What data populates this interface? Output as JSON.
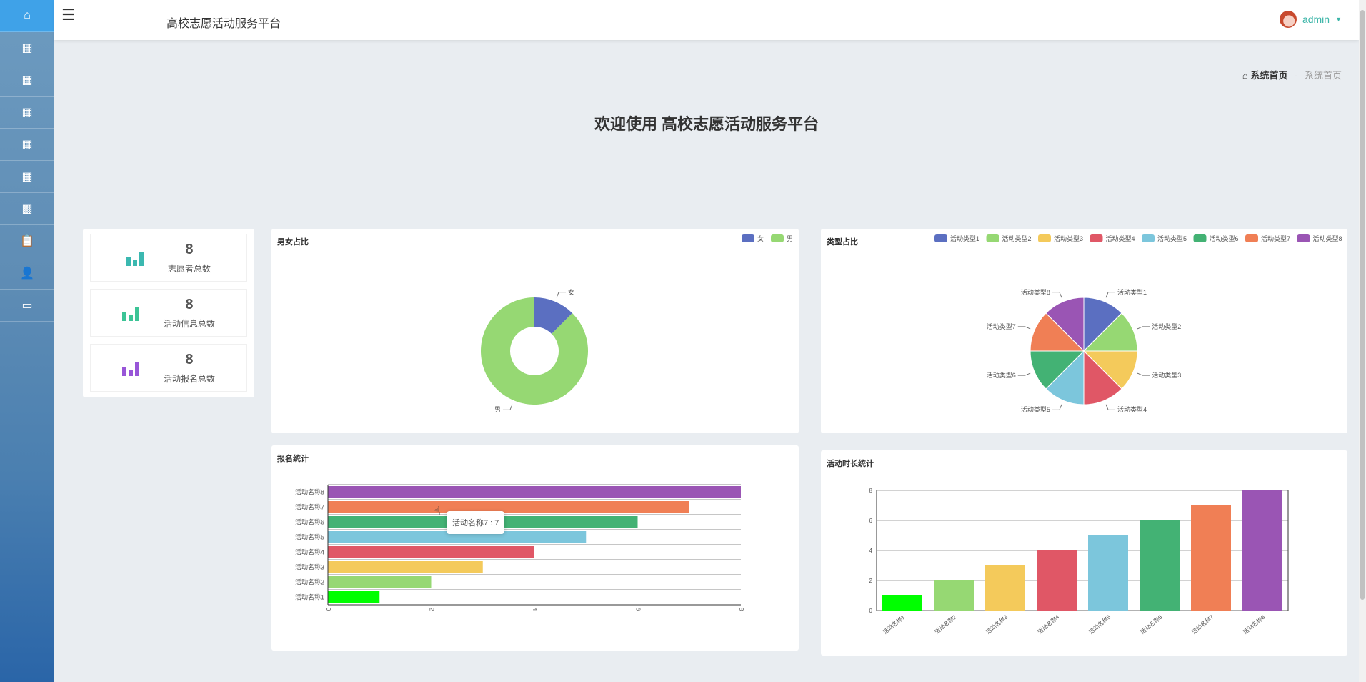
{
  "header": {
    "app_title": "高校志愿活动服务平台",
    "user": "admin"
  },
  "sidebar": {
    "items": [
      {
        "icon": "home-icon"
      },
      {
        "icon": "grid-icon"
      },
      {
        "icon": "grid-icon"
      },
      {
        "icon": "grid-icon"
      },
      {
        "icon": "grid-icon"
      },
      {
        "icon": "grid-icon"
      },
      {
        "icon": "apps-icon"
      },
      {
        "icon": "clipboard-icon"
      },
      {
        "icon": "user-icon"
      },
      {
        "icon": "card-icon"
      }
    ]
  },
  "breadcrumb": {
    "home": "系统首页",
    "sep": "-",
    "current": "系统首页"
  },
  "welcome": "欢迎使用 高校志愿活动服务平台",
  "stats": [
    {
      "value": "8",
      "label": "志愿者总数",
      "color": "#3bb8b0"
    },
    {
      "value": "8",
      "label": "活动信息总数",
      "color": "#3cc496"
    },
    {
      "value": "8",
      "label": "活动报名总数",
      "color": "#9856d8"
    }
  ],
  "colors": [
    "#5b6fc1",
    "#96d873",
    "#f4ca5b",
    "#e05766",
    "#7cc6dc",
    "#43b274",
    "#f07f55",
    "#9a55b4"
  ],
  "chart_data": [
    {
      "type": "pie",
      "title": "男女占比",
      "donut": true,
      "labels": [
        "女",
        "男"
      ],
      "values": [
        1,
        7
      ],
      "legend": "top-right"
    },
    {
      "type": "pie",
      "title": "类型占比",
      "labels": [
        "活动类型1",
        "活动类型2",
        "活动类型3",
        "活动类型4",
        "活动类型5",
        "活动类型6",
        "活动类型7",
        "活动类型8"
      ],
      "values": [
        1,
        1,
        1,
        1,
        1,
        1,
        1,
        1
      ],
      "legend": "top-right"
    },
    {
      "type": "bar",
      "orientation": "horizontal",
      "title": "报名统计",
      "categories": [
        "活动名称1",
        "活动名称2",
        "活动名称3",
        "活动名称4",
        "活动名称5",
        "活动名称6",
        "活动名称7",
        "活动名称8"
      ],
      "values": [
        1,
        2,
        3,
        4,
        5,
        6,
        7,
        8
      ],
      "xlim": [
        0,
        8
      ],
      "ticks": [
        "0",
        "2",
        "4",
        "6",
        "8"
      ],
      "tooltip": "活动名称7 : 7"
    },
    {
      "type": "bar",
      "title": "活动时长统计",
      "categories": [
        "活动名称1",
        "活动名称2",
        "活动名称3",
        "活动名称4",
        "活动名称5",
        "活动名称6",
        "活动名称7",
        "活动名称8"
      ],
      "values": [
        1,
        2,
        3,
        4,
        5,
        6,
        7,
        8
      ],
      "ylim": [
        0,
        8
      ],
      "ticks": [
        "0",
        "2",
        "4",
        "6",
        "8"
      ]
    }
  ]
}
